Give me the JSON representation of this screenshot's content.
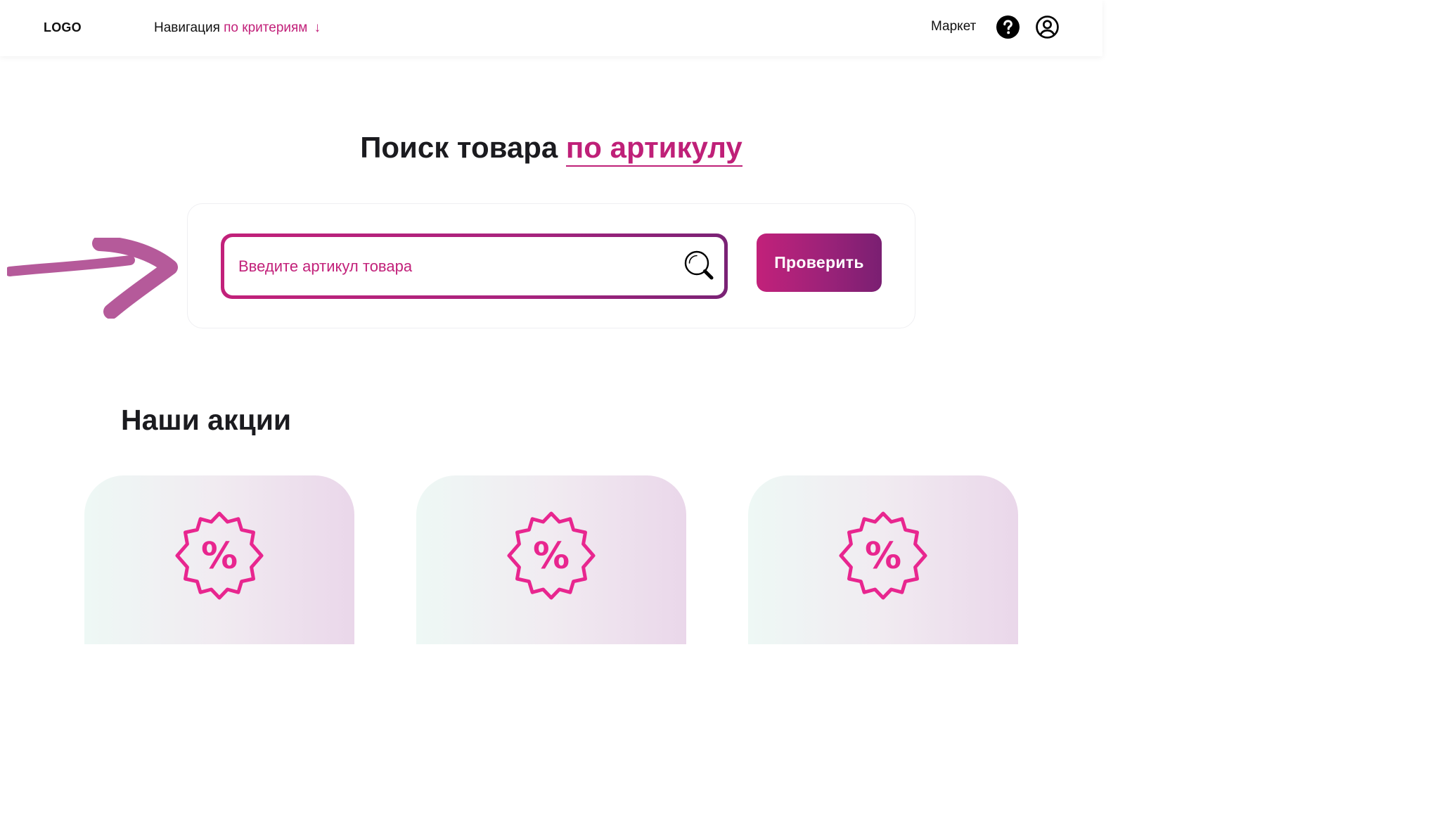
{
  "header": {
    "logo": "LOGO",
    "nav_label": "Навигация",
    "nav_accent": "по критериям",
    "nav_arrow": "↓",
    "market_link": "Маркет",
    "help_icon": "question-circle-icon",
    "user_icon": "user-circle-icon"
  },
  "search_section": {
    "title_main": "Поиск товара",
    "title_accent": "по артикулу",
    "input_placeholder": "Введите артикул товара",
    "input_value": "",
    "button_label": "Проверить"
  },
  "promos": {
    "title": "Наши акции",
    "cards": [
      {
        "icon": "discount-badge-icon"
      },
      {
        "icon": "discount-badge-icon"
      },
      {
        "icon": "discount-badge-icon"
      }
    ]
  },
  "colors": {
    "accent": "#c2217a",
    "accent_dark": "#7a1f72",
    "badge": "#e8268f",
    "arrow": "#b55a9a"
  }
}
